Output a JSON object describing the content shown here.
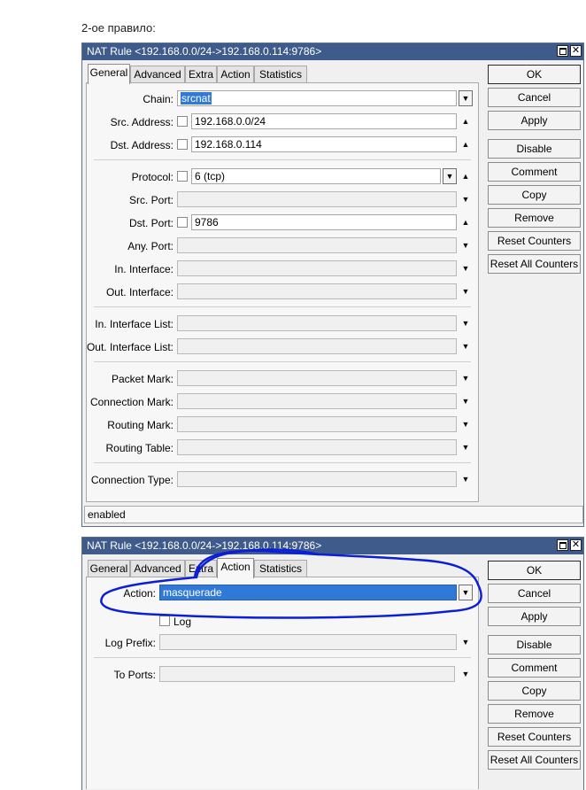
{
  "caption": "2-ое правило:",
  "window1": {
    "title": "NAT Rule <192.168.0.0/24->192.168.0.114:9786>",
    "tabs": [
      "General",
      "Advanced",
      "Extra",
      "Action",
      "Statistics"
    ],
    "active_tab": "General",
    "fields": {
      "chain": {
        "label": "Chain:",
        "value": "srcnat"
      },
      "src_address": {
        "label": "Src. Address:",
        "value": "192.168.0.0/24"
      },
      "dst_address": {
        "label": "Dst. Address:",
        "value": "192.168.0.114"
      },
      "protocol": {
        "label": "Protocol:",
        "value": "6 (tcp)"
      },
      "src_port": {
        "label": "Src. Port:",
        "value": ""
      },
      "dst_port": {
        "label": "Dst. Port:",
        "value": "9786"
      },
      "any_port": {
        "label": "Any. Port:",
        "value": ""
      },
      "in_interface": {
        "label": "In. Interface:",
        "value": ""
      },
      "out_interface": {
        "label": "Out. Interface:",
        "value": ""
      },
      "in_interface_list": {
        "label": "In. Interface List:",
        "value": ""
      },
      "out_interface_list": {
        "label": "Out. Interface List:",
        "value": ""
      },
      "packet_mark": {
        "label": "Packet Mark:",
        "value": ""
      },
      "connection_mark": {
        "label": "Connection Mark:",
        "value": ""
      },
      "routing_mark": {
        "label": "Routing Mark:",
        "value": ""
      },
      "routing_table": {
        "label": "Routing Table:",
        "value": ""
      },
      "connection_type": {
        "label": "Connection Type:",
        "value": ""
      }
    },
    "buttons": [
      "OK",
      "Cancel",
      "Apply",
      "Disable",
      "Comment",
      "Copy",
      "Remove",
      "Reset Counters",
      "Reset All Counters"
    ],
    "status": "enabled"
  },
  "window2": {
    "title": "NAT Rule <192.168.0.0/24->192.168.0.114:9786>",
    "tabs": [
      "General",
      "Advanced",
      "Extra",
      "Action",
      "Statistics"
    ],
    "active_tab": "Action",
    "fields": {
      "action": {
        "label": "Action:",
        "value": "masquerade"
      },
      "log": {
        "label": "Log"
      },
      "log_prefix": {
        "label": "Log Prefix:",
        "value": ""
      },
      "to_ports": {
        "label": "To Ports:",
        "value": ""
      }
    },
    "buttons": [
      "OK",
      "Cancel",
      "Apply",
      "Disable",
      "Comment",
      "Copy",
      "Remove",
      "Reset Counters",
      "Reset All Counters"
    ]
  },
  "colors": {
    "titlebar": "#3f5b8c",
    "selection": "#3179d6",
    "annotation": "#0a1fd6"
  },
  "icons": {
    "maximize": "restore-window-icon",
    "close": "close-icon",
    "dropdown": "dropdown-arrow-icon",
    "expand": "triangle-up-icon",
    "collapse": "triangle-down-icon"
  }
}
